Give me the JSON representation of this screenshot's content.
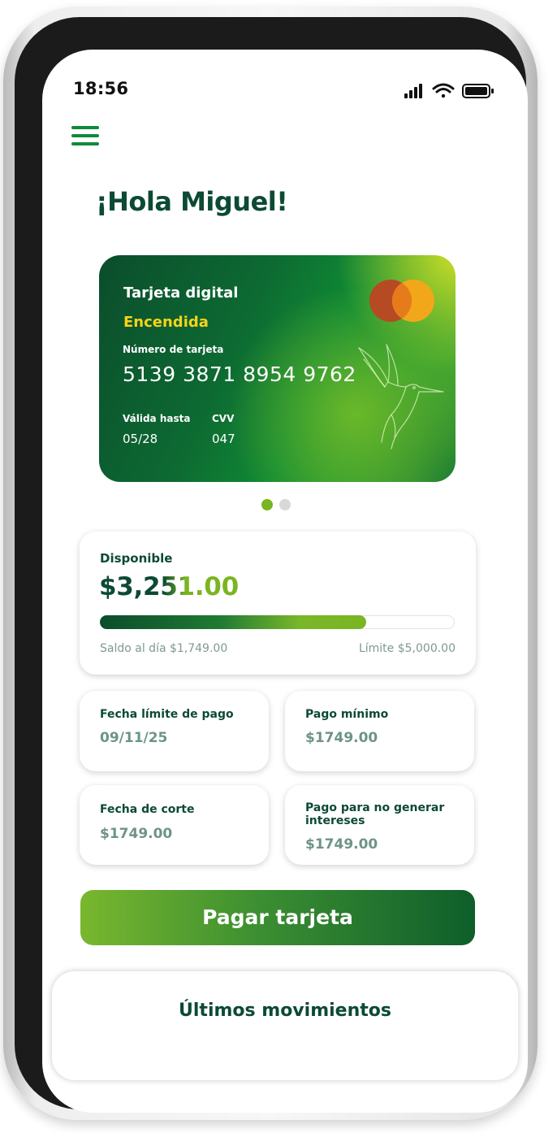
{
  "status_bar": {
    "time": "18:56",
    "icons": [
      "cellular-signal-icon",
      "wifi-icon",
      "battery-icon"
    ]
  },
  "header": {
    "menu_icon": "hamburger-menu-icon",
    "greeting": "¡Hola Miguel!"
  },
  "card": {
    "title": "Tarjeta digital",
    "status": "Encendida",
    "number_label": "Número de tarjeta",
    "number": "5139 3871 8954 9762",
    "valid_label": "Válida hasta",
    "valid": "05/28",
    "cvv_label": "CVV",
    "cvv": "047",
    "brand_icon": "mastercard-logo-icon",
    "decor_icon": "hummingbird-icon"
  },
  "carousel": {
    "total": 2,
    "active": 1
  },
  "balance": {
    "label": "Disponible",
    "amount": "$3,251.00",
    "saldo": "Saldo al día $1,749.00",
    "limit": "Límite $5,000.00",
    "used_fraction": 0.75
  },
  "info_cards": [
    {
      "label": "Fecha límite de pago",
      "value": "09/11/25"
    },
    {
      "label": "Pago mínimo",
      "value": "$1749.00"
    },
    {
      "label": "Fecha de corte",
      "value": "$1749.00"
    },
    {
      "label": "Pago para no generar intereses",
      "value": "$1749.00"
    }
  ],
  "actions": {
    "pay_label": "Pagar tarjeta"
  },
  "movements": {
    "title": "Últimos movimientos"
  },
  "colors": {
    "primary_dark": "#0c4a33",
    "accent_green": "#7ab521",
    "brand_green": "#0f8a3c",
    "card_status": "#f5d31a"
  }
}
